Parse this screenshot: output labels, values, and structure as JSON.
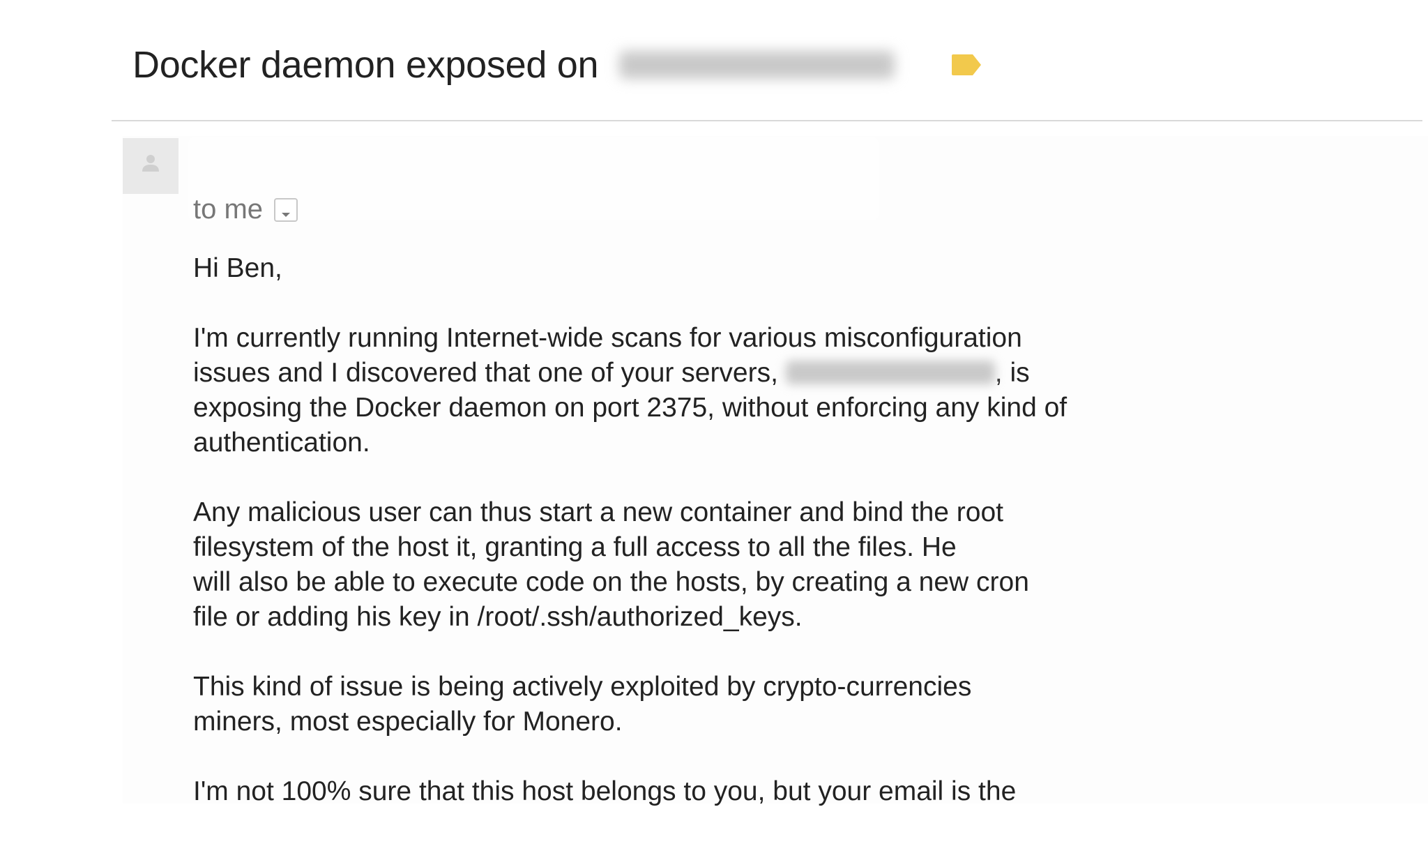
{
  "subject": {
    "title": "Docker daemon exposed on",
    "label_color": "#f2c94c"
  },
  "header": {
    "avatar_icon": "person-icon",
    "recipient": "to me",
    "dropdown_icon": "chevron-down-icon"
  },
  "body": {
    "greeting": "Hi Ben,",
    "p1_line1": "I'm currently running Internet-wide scans for various misconfiguration",
    "p1_line2_before": "issues and I discovered that one of your servers, ",
    "p1_line2_after": ", is",
    "p1_line3": "exposing the Docker daemon on port 2375, without enforcing any kind of",
    "p1_line4": "authentication.",
    "p2_line1": "Any malicious user can thus start a new container and bind the root",
    "p2_line2": "filesystem of the host it, granting a full access to all the files. He",
    "p2_line3": "will also be able to execute code on the hosts, by creating a new cron",
    "p2_line4": "file or adding his key in /root/.ssh/authorized_keys.",
    "p3_line1": "This kind of issue is being actively exploited by crypto-currencies",
    "p3_line2": "miners, most especially for Monero.",
    "p4_line1": "I'm not 100% sure that this host belongs to you, but your email is the"
  }
}
